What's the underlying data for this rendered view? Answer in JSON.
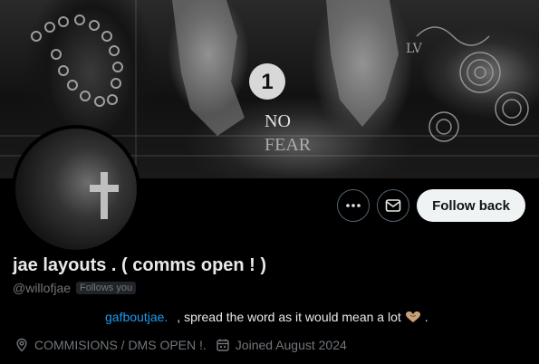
{
  "profile": {
    "display_name": "jae layouts . ( comms open ! )",
    "handle": "@willofjae",
    "follows_badge": "Follows you",
    "bio_link": "gafboutjae.",
    "bio_text": ", spread the word as it would mean a lot",
    "bio_end": ".",
    "location": "COMMISIONS /  DMS OPEN !.",
    "joined": "Joined August 2024"
  },
  "banner": {
    "badge_number": "1",
    "text_line1": "NO",
    "text_line2": "FEAR"
  },
  "actions": {
    "more_icon": "more-horizontal-icon",
    "message_icon": "mail-icon",
    "follow_label": "Follow back"
  },
  "colors": {
    "background": "#000000",
    "text": "#e7e9ea",
    "secondary": "#71767b",
    "link": "#1d9bf0",
    "follow_bg": "#eff3f4",
    "heart": "#c8a27a"
  }
}
